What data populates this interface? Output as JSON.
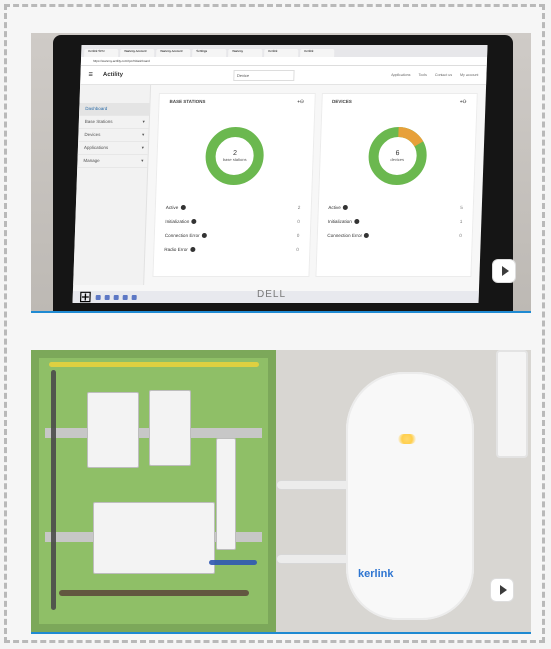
{
  "top_media": {
    "browser_tabs": [
      "Kerlink SPN",
      "Wanesy Account",
      "Wanesy Account",
      "Settings",
      "Wanesy",
      "Kerlink",
      "Kerlink"
    ],
    "address": "https://wanesy.actility.com/tpe/#/dashboard",
    "app": {
      "brand": "Actility",
      "device_select": "Device",
      "header_right": [
        "Applications",
        "Tools",
        "Contact us",
        "My account"
      ]
    },
    "sidebar": [
      {
        "label": "Dashboard"
      },
      {
        "label": "Base Stations"
      },
      {
        "label": "Devices"
      },
      {
        "label": "Applications"
      },
      {
        "label": "Manage"
      }
    ],
    "cards": [
      {
        "title": "BASE STATIONS",
        "total": "2",
        "caption": "base stations",
        "stats": [
          {
            "label": "Active",
            "value": "2"
          },
          {
            "label": "Initialization",
            "value": "0"
          },
          {
            "label": "Connection Error",
            "value": "0"
          },
          {
            "label": "Radio Error",
            "value": "0"
          }
        ]
      },
      {
        "title": "DEVICES",
        "total": "6",
        "caption": "devices",
        "stats": [
          {
            "label": "Active",
            "value": "5"
          },
          {
            "label": "Initialization",
            "value": "1"
          },
          {
            "label": "Connection Error",
            "value": "0"
          }
        ]
      }
    ],
    "laptop_brand": "DELL"
  },
  "bottom_media": {
    "router_brand": "kerlink"
  },
  "icons": {
    "play_badge": "play-icon",
    "add_icon": "add-icon",
    "info_icon": "info-icon"
  },
  "colors": {
    "accent_blue": "#1f8ad2",
    "donut_green": "#6bb84f",
    "donut_orange": "#e7a03a"
  }
}
